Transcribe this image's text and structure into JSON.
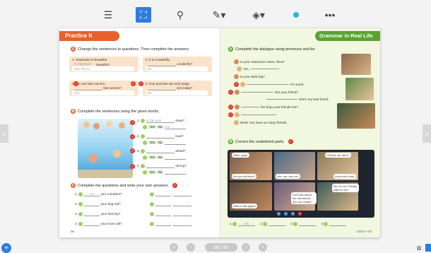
{
  "toolbar": {
    "icons": [
      "menu-icon",
      "fullscreen-icon",
      "zoom-icon",
      "pen-icon",
      "eraser-icon",
      "color-dot-icon",
      "more-icon"
    ],
    "accent": "#2f7ce0"
  },
  "left_page": {
    "banner": "Practice It",
    "banner_color": "#e8602d",
    "sec_a": {
      "num": "A",
      "title": "Change the sentences to questions. Then complete the answers."
    },
    "cards": [
      {
        "n": "1.",
        "text": "Stephanie is beautiful.",
        "q": "Is Stephanie",
        "q2": "beautiful?",
        "ans": "Yes,  she is."
      },
      {
        "n": "2.",
        "text": "It is a butterfly.",
        "q": "",
        "q2": "a butterfly?",
        "ans": "No,"
      },
      {
        "n": "3.",
        "text": "You are fast runners.",
        "q": "",
        "q2": "fast runners?",
        "ans": "Yes,"
      },
      {
        "n": "4.",
        "text": "Roy and Dan are sick today.",
        "q": "",
        "q2": "sick today?",
        "ans": "No,"
      }
    ],
    "sec_b": {
      "num": "B",
      "title": "Complete the sentences using the given words."
    },
    "b_rows": [
      {
        "n": "1.",
        "a": "Is the pool",
        "b": "deep?",
        "yes": "Yes",
        "no": "No",
        "ans": "it is."
      },
      {
        "n": "2.",
        "a": "",
        "b": "loud?",
        "yes": "Yes",
        "no": "No",
        "ans": ""
      },
      {
        "n": "3.",
        "a": "",
        "b": "afraid?",
        "yes": "Yes",
        "no": "No",
        "ans": ""
      },
      {
        "n": "4.",
        "a": "",
        "b": "strong?",
        "yes": "Yes",
        "no": "No",
        "ans": ""
      }
    ],
    "sec_c": {
      "num": "C",
      "title": "Complete the questions and write your own answers."
    },
    "c_rows": [
      {
        "n": "1.",
        "pre": "Are",
        "q": "you a student?"
      },
      {
        "n": "2.",
        "pre": "",
        "q": "your bag red?"
      },
      {
        "n": "3.",
        "pre": "",
        "q": "your feet big?"
      },
      {
        "n": "4.",
        "pre": "",
        "q": "your mom tall?"
      }
    ],
    "page_num": "36"
  },
  "right_page": {
    "banner": "Grammar in Real Life",
    "banner_color": "#5aa332",
    "sec_a": {
      "num": "A",
      "title": "Complete the dialogue using pronouns and be."
    },
    "dialogue": [
      "Is your classroom clean, Nina?",
      "Yes,",
      "Is your desk big?",
      "It's small.",
      "she your friend?",
      "She's my best friend.",
      "the boys your friends too?",
      "",
      "Wow! You have so many friends."
    ],
    "sec_b": {
      "num": "B",
      "title": "Correct the underlined parts."
    },
    "video_bubbles": [
      "Hello, guys.",
      "Hi Nina, we aren't.",
      "Are you all there?",
      "Yes, we I are not.",
      "Kevin isn't here.",
      "No, it's not. Please wait for me!",
      "Let's talk about the homework. Are you ready?",
      "Ditto is late again!"
    ],
    "answer_nums": [
      "1",
      "2",
      "3",
      "4"
    ],
    "answer_first": "are",
    "page_num": "Unit 8 • 37"
  },
  "nav": {
    "page_indicator": "36 / 56",
    "first": "«",
    "prev": "‹",
    "next": "›",
    "last": "»"
  }
}
